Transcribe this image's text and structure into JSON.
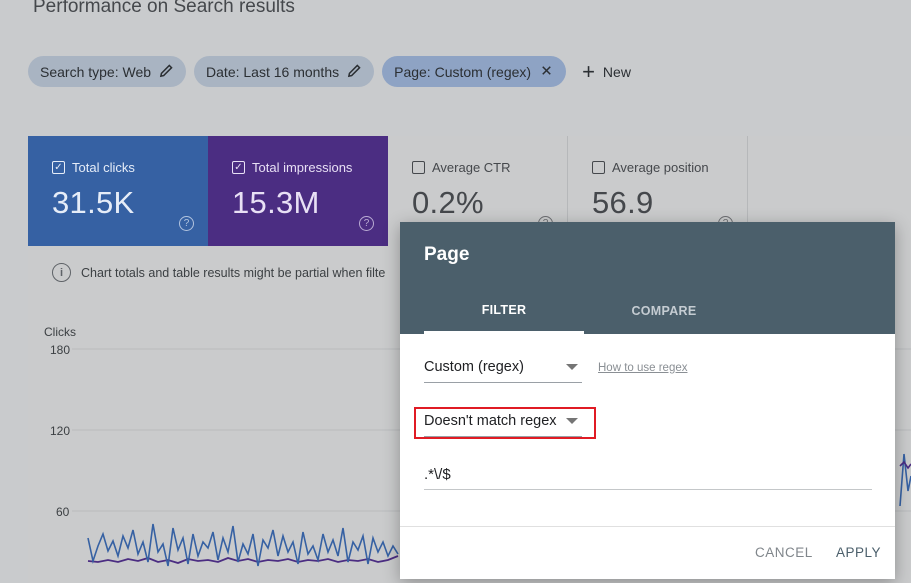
{
  "page": {
    "title": "Performance on Search results"
  },
  "filters": [
    {
      "label": "Search type: Web",
      "icon": "pencil-icon"
    },
    {
      "label": "Date: Last 16 months",
      "icon": "pencil-icon"
    },
    {
      "label": "Page: Custom (regex)",
      "icon": "close-icon"
    }
  ],
  "new_button": {
    "label": "New"
  },
  "metrics": {
    "clicks": {
      "label": "Total clicks",
      "value": "31.5K",
      "checked": true
    },
    "impressions": {
      "label": "Total impressions",
      "value": "15.3M",
      "checked": true
    },
    "ctr": {
      "label": "Average CTR",
      "value": "0.2%",
      "checked": false
    },
    "position": {
      "label": "Average position",
      "value": "56.9",
      "checked": false
    }
  },
  "notice": {
    "text": "Chart totals and table results might be partial when filte"
  },
  "chart": {
    "ylabel": "Clicks",
    "ticks": [
      "180",
      "120",
      "60"
    ]
  },
  "dialog": {
    "title": "Page",
    "tabs": {
      "filter": "FILTER",
      "compare": "COMPARE"
    },
    "filter_type": "Custom (regex)",
    "howto_link": "How to use regex",
    "match_mode": "Doesn't match regex",
    "regex_value": ".*\\/$",
    "cancel": "CANCEL",
    "apply": "APPLY"
  },
  "colors": {
    "clicks": "#3661a3",
    "impressions": "#4b2d82",
    "dialog_header": "#4b5f6b",
    "highlight": "#e01b24"
  }
}
